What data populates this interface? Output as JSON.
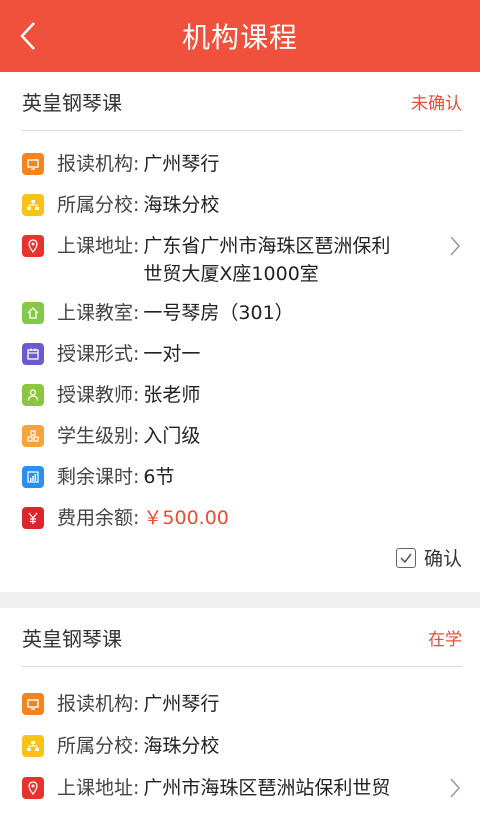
{
  "header": {
    "title": "机构课程",
    "back_icon": "chevron-left-icon"
  },
  "colors": {
    "header_bg": "#f0513c",
    "accent": "#ee4b34",
    "icon_institution": "#f5841f",
    "icon_branch": "#f8c21b",
    "icon_address": "#e8322e",
    "icon_classroom": "#83c847",
    "icon_format": "#6a5ccf",
    "icon_teacher": "#8cc63f",
    "icon_level": "#f8a23a",
    "icon_remaining": "#2d8ff0",
    "icon_balance": "#d8262a"
  },
  "courses": [
    {
      "name": "英皇钢琴课",
      "status": "未确认",
      "rows": {
        "institution": {
          "label": "报读机构:",
          "value": "广州琴行"
        },
        "branch": {
          "label": "所属分校:",
          "value": "海珠分校"
        },
        "address": {
          "label": "上课地址:",
          "value_line1": "广东省广州市海珠区琶洲保利",
          "value_line2": "世贸大厦X座1000室"
        },
        "classroom": {
          "label": "上课教室:",
          "value": "一号琴房（301）"
        },
        "format": {
          "label": "授课形式:",
          "value": "一对一"
        },
        "teacher": {
          "label": "授课教师:",
          "value": "张老师"
        },
        "level": {
          "label": "学生级别:",
          "value": "入门级"
        },
        "remaining": {
          "label": "剩余课时:",
          "value": "6节"
        },
        "balance": {
          "label": "费用余额:",
          "value": "￥500.00"
        }
      },
      "confirm_label": "确认"
    },
    {
      "name": "英皇钢琴课",
      "status": "在学",
      "rows": {
        "institution": {
          "label": "报读机构:",
          "value": "广州琴行"
        },
        "branch": {
          "label": "所属分校:",
          "value": "海珠分校"
        },
        "address": {
          "label": "上课地址:",
          "value_line1": "广州市海珠区琶洲站保利世贸"
        }
      }
    }
  ]
}
